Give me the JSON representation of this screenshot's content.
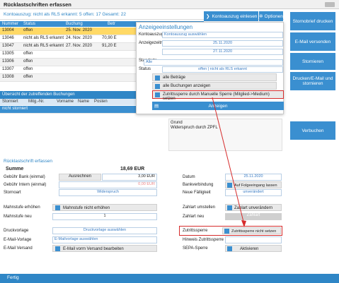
{
  "window": {
    "title": "Rücklastschriften erfassen"
  },
  "summary": "Kontoauszug: nicht als RLS erkannt: 5 offen: 17 Gesamt: 22",
  "top_table": {
    "headers": [
      "Nummer",
      "Status",
      "Buchung",
      "Betr"
    ],
    "rows": [
      [
        "13004",
        "offen",
        "25. Nov. 2020",
        ""
      ],
      [
        "13046",
        "nicht als RLS erkannt",
        "24. Nov. 2020",
        "70,90 E"
      ],
      [
        "13047",
        "nicht als RLS erkannt",
        "27. Nov. 2020",
        "91,20 E"
      ],
      [
        "13305",
        "offen",
        "",
        ""
      ],
      [
        "13306",
        "offen",
        "",
        ""
      ],
      [
        "13307",
        "offen",
        "",
        ""
      ],
      [
        "13308",
        "offen",
        "",
        ""
      ]
    ]
  },
  "header_buttons": {
    "kontoauszug": "Kontoauszug einlesen",
    "optionen": "Optionen"
  },
  "buchungen_section": {
    "title": "Übersicht der zutreffenden Buchungen",
    "headers": [
      "Storniert",
      "Mitg.-Nr.",
      "Vorname",
      "Name",
      "Posten"
    ],
    "row": [
      "nicht storniert"
    ]
  },
  "dialog": {
    "title": "Anzeigeeinstellungen",
    "kontoauszug_label": "Kontoauszug",
    "kontoauszug_value": "Kontoauszug auswählen",
    "zeitraum_label": "Anzeigezeitraum",
    "date_from": "25.11.2020",
    "date_to": "27.11.2020",
    "standorte_label": "Standorte",
    "standorte_value": "Alle",
    "status_label": "Status",
    "status_value": "offen | nicht als RLS erkannt",
    "opt_alle_betraege": "alle Beträge",
    "opt_alle_buchungen": "alle Buchungen anzeigen",
    "opt_zutritt": "Zutrittssperre durch Manuelle Sperre (Mitglied->Medium) setzen",
    "anzeigen_btn": "Anzeigen"
  },
  "grund": {
    "label": "Grund",
    "value": "Widerspruch durch ZPFL"
  },
  "rls_form": {
    "title": "Rücklastschrift erfassen",
    "summe_label": "Summe",
    "summe_value": "18,69 EUR",
    "gebuehr_bank_label": "Gebühr Bank (einmal)",
    "ausrechnen": "Ausrechnen",
    "gebuehr_bank_value": "3,00 EUR",
    "gebuehr_intern_label": "Gebühr Intern (einmal)",
    "gebuehr_intern_value": "0,00 EUR",
    "stornoart_label": "Stornoart",
    "stornoart_value": "Widerspruch",
    "mahnstufe_erhoehen_label": "Mahnstufe erhöhen",
    "mahnstufe_erhoehen_value": "Mahnstufe nicht erhöhen",
    "mahnstufe_neu_label": "Mahnstufe neu",
    "mahnstufe_neu_value": "1",
    "druckvorlage_label": "Druckvorlage",
    "druckvorlage_value": "Druckvorlage auswählen",
    "email_vorlage_label": "E-Mail-Vorlage",
    "email_vorlage_value": "E-Mailvorlage auswählen",
    "email_versand_label": "E-Mail Versand",
    "email_versand_value": "E-Mail vorm Versand bearbeiten",
    "datum_label": "Datum",
    "datum_value": "25.11.2020",
    "bankverbindung_label": "Bankverbindung",
    "bankverbindung_value": "Auf Folgeeingang lassen",
    "faelligkeit_label": "Neue Fälligkeit",
    "faelligkeit_value": "unverändert",
    "zahlart_umstellen_label": "Zahlart umstellen",
    "zahlart_umstellen_value": "Zahlart unverändern",
    "zahlart_neu_label": "Zahlart neu",
    "zahlart_neu_value": "Zahlart",
    "zutrittssperre_label": "Zutrittssperre",
    "zutrittssperre_value": "Zutrittssperre nicht setzen",
    "hinweis_label": "Hinweis Zutrittssperre",
    "sepa_label": "SEPA-Sperre",
    "sepa_value": "Aktivieren"
  },
  "sidebar": {
    "btn1": "Stornobrief drucken",
    "btn2": "E-Mail versenden",
    "btn3": "Stornieren",
    "btn4": "Drucken/E-Mail und stornieren",
    "btn5": "Verbuchen"
  },
  "footer": {
    "fertig": "Fertig"
  },
  "colors": {
    "accent": "#2f86c6",
    "highlight_row": "#ffd966",
    "annotation_red": "#d62b2b"
  }
}
